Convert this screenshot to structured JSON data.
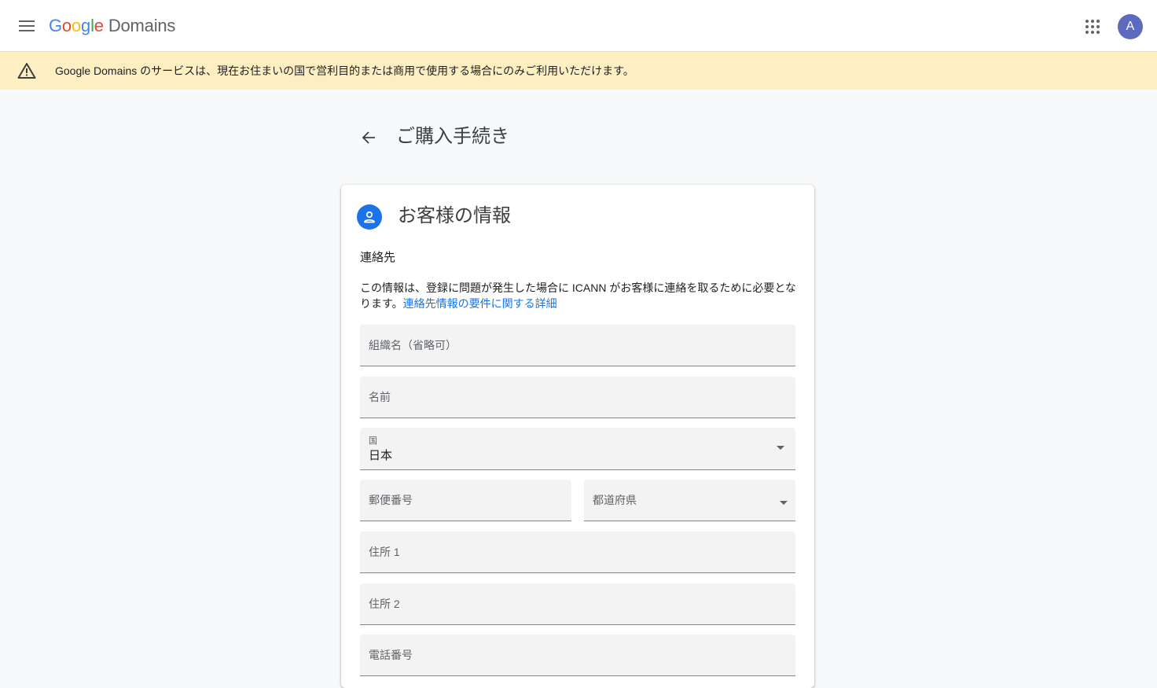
{
  "header": {
    "logo_letters": [
      "G",
      "o",
      "o",
      "g",
      "l",
      "e"
    ],
    "product": "Domains",
    "avatar_initial": "A"
  },
  "banner": {
    "text": "Google Domains のサービスは、現在お住まいの国で営利目的または商用で使用する場合にのみご利用いただけます。"
  },
  "page": {
    "title": "ご購入手続き"
  },
  "card": {
    "title": "お客様の情報",
    "section_label": "連絡先",
    "description": "この情報は、登録に問題が発生した場合に ICANN がお客様に連絡を取るために必要となります。",
    "link_text": "連絡先情報の要件に関する詳細"
  },
  "form": {
    "organization_placeholder": "組織名（省略可）",
    "name_placeholder": "名前",
    "country_label": "国",
    "country_value": "日本",
    "postal_placeholder": "郵便番号",
    "prefecture_placeholder": "都道府県",
    "address1_placeholder": "住所 1",
    "address2_placeholder": "住所 2",
    "phone_placeholder": "電話番号"
  },
  "colors": {
    "accent": "#1a73e8",
    "banner_bg": "#feefc3",
    "avatar_bg": "#5c6bc0"
  },
  "icons": {
    "menu": "menu-icon",
    "apps": "apps-grid-icon",
    "warning": "warning-icon",
    "back": "arrow-back-icon",
    "person": "person-icon",
    "dropdown": "chevron-down-icon"
  }
}
